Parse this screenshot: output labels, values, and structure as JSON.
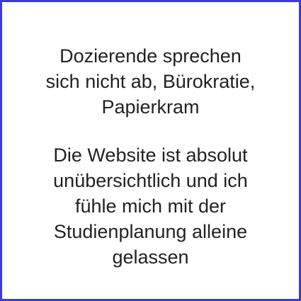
{
  "card": {
    "border_color": "#3b3bd6",
    "paragraphs": [
      {
        "lines": [
          "Dozierende sprechen",
          "sich nicht ab, Bürokratie,",
          "Papierkram"
        ]
      },
      {
        "lines": [
          "Die Website ist absolut",
          "unübersichtlich und ich",
          "fühle mich mit der",
          "Studienplanung alleine",
          "gelassen"
        ]
      }
    ]
  }
}
